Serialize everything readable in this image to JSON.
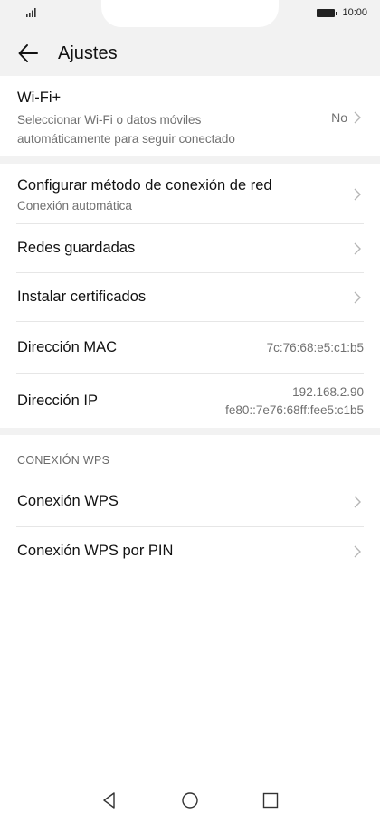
{
  "status": {
    "time": "10:00"
  },
  "header": {
    "title": "Ajustes"
  },
  "wifiplus": {
    "title": "Wi-Fi+",
    "subtitle_line1": "Seleccionar Wi-Fi o datos móviles",
    "subtitle_line2": "automáticamente para seguir conectado",
    "value": "No"
  },
  "network": {
    "config_title": "Configurar método de conexión de red",
    "config_sub": "Conexión automática",
    "saved_title": "Redes guardadas",
    "certs_title": "Instalar certificados",
    "mac_title": "Dirección MAC",
    "mac_value": "7c:76:68:e5:c1:b5",
    "ip_title": "Dirección IP",
    "ip_value_v4": "192.168.2.90",
    "ip_value_v6": "fe80::7e76:68ff:fee5:c1b5"
  },
  "wps": {
    "section_label": "CONEXIÓN WPS",
    "wps_title": "Conexión WPS",
    "wps_pin_title": "Conexión WPS por PIN"
  },
  "icons": {
    "back": "back-arrow-icon",
    "chevron": "chevron-right-icon",
    "nav_back": "triangle-back-icon",
    "nav_home": "circle-home-icon",
    "nav_recent": "square-recent-icon"
  }
}
